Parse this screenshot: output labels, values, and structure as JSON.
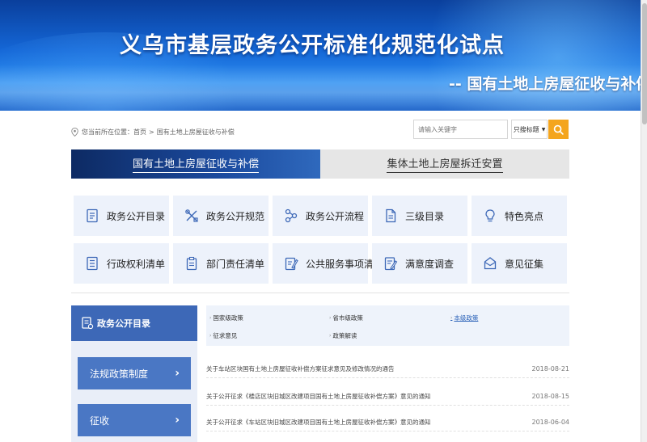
{
  "banner": {
    "title": "义乌市基层政务公开标准化规范化试点",
    "subtitle": "-- 国有土地上房屋征收与补偿"
  },
  "breadcrumb": {
    "prefix": "您当前所在位置：",
    "home": "首页",
    "separator": ">",
    "current": "国有土地上房屋征收与补偿"
  },
  "search": {
    "placeholder": "请输入关键字",
    "scope": "只搜标题",
    "button_icon": "search-icon"
  },
  "tabs": [
    {
      "label": "国有土地上房屋征收与补偿",
      "active": true
    },
    {
      "label": "集体土地上房屋拆迁安置",
      "active": false
    }
  ],
  "grid": [
    {
      "label": "政务公开目录",
      "icon": "document-list-icon"
    },
    {
      "label": "政务公开规范",
      "icon": "tools-icon"
    },
    {
      "label": "政务公开流程",
      "icon": "flow-icon"
    },
    {
      "label": "三级目录",
      "icon": "document-icon"
    },
    {
      "label": "特色亮点",
      "icon": "lightbulb-icon"
    },
    {
      "label": "行政权利清单",
      "icon": "list-icon"
    },
    {
      "label": "部门责任清单",
      "icon": "clipboard-icon"
    },
    {
      "label": "公共服务事项清单",
      "icon": "edit-document-icon"
    },
    {
      "label": "满意度调查",
      "icon": "survey-icon"
    },
    {
      "label": "意见征集",
      "icon": "mailbox-icon"
    }
  ],
  "sidebar": {
    "header": "政务公开目录",
    "items": [
      {
        "label": "法规政策制度"
      },
      {
        "label": "征收"
      }
    ]
  },
  "categories": [
    {
      "label": "国家级政策",
      "active": false
    },
    {
      "label": "省市级政策",
      "active": false
    },
    {
      "label": "本级政策",
      "active": true
    },
    {
      "label": "征求意见",
      "active": false
    },
    {
      "label": "政策解读",
      "active": false
    }
  ],
  "news": [
    {
      "title": "关于车站区块国有土地上房屋征收补偿方案征求意见及修改情况的通告",
      "date": "2018-08-21"
    },
    {
      "title": "关于公开征求《楼店区块旧城区改建项目国有土地上房屋征收补偿方案》意见的通知",
      "date": "2018-08-15"
    },
    {
      "title": "关于公开征求《车站区块旧城区改建项目国有土地上房屋征收补偿方案》意见的通知",
      "date": "2018-06-04"
    }
  ],
  "colors": {
    "accent_orange": "#f4a51e",
    "tab_active": "#1b4a9e",
    "sidebar_blue": "#3d68b7",
    "tile_bg": "#edf2fb"
  }
}
